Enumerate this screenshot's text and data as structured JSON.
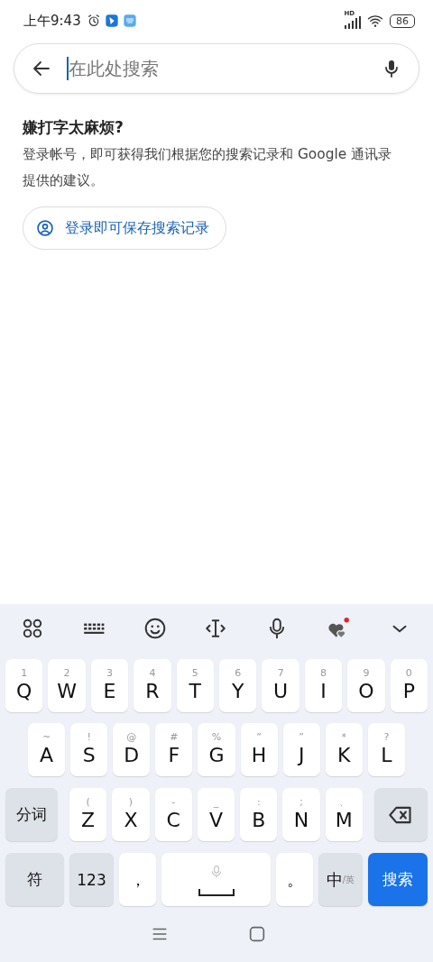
{
  "status_bar": {
    "time": "上午9:43",
    "network": "HD",
    "battery": "86"
  },
  "search": {
    "placeholder": "在此处搜索"
  },
  "prompt": {
    "title": "嫌打字太麻烦?",
    "text": "登录帐号，即可获得我们根据您的搜索记录和 Google 通讯录提供的建议。",
    "button": "登录即可保存搜索记录"
  },
  "keyboard": {
    "toolbar": [
      {
        "kind": "grid"
      },
      {
        "kind": "keyboard"
      },
      {
        "kind": "emoji"
      },
      {
        "kind": "cursor"
      },
      {
        "kind": "mic"
      },
      {
        "kind": "hearts"
      },
      {
        "kind": "collapse"
      }
    ],
    "rows": [
      {
        "keys": [
          {
            "kind": "letter",
            "label": "Q",
            "hint": "1"
          },
          {
            "kind": "letter",
            "label": "W",
            "hint": "2"
          },
          {
            "kind": "letter",
            "label": "E",
            "hint": "3"
          },
          {
            "kind": "letter",
            "label": "R",
            "hint": "4"
          },
          {
            "kind": "letter",
            "label": "T",
            "hint": "5"
          },
          {
            "kind": "letter",
            "label": "Y",
            "hint": "6"
          },
          {
            "kind": "letter",
            "label": "U",
            "hint": "7"
          },
          {
            "kind": "letter",
            "label": "I",
            "hint": "8"
          },
          {
            "kind": "letter",
            "label": "O",
            "hint": "9"
          },
          {
            "kind": "letter",
            "label": "P",
            "hint": "0"
          }
        ]
      },
      {
        "keys": [
          {
            "kind": "letter",
            "label": "A",
            "hint": "~"
          },
          {
            "kind": "letter",
            "label": "S",
            "hint": "!"
          },
          {
            "kind": "letter",
            "label": "D",
            "hint": "@"
          },
          {
            "kind": "letter",
            "label": "F",
            "hint": "#"
          },
          {
            "kind": "letter",
            "label": "G",
            "hint": "%"
          },
          {
            "kind": "letter",
            "label": "H",
            "hint": "“"
          },
          {
            "kind": "letter",
            "label": "J",
            "hint": "”"
          },
          {
            "kind": "letter",
            "label": "K",
            "hint": "*"
          },
          {
            "kind": "letter",
            "label": "L",
            "hint": "?"
          }
        ]
      },
      {
        "keys": [
          {
            "kind": "function",
            "label": "分词"
          },
          {
            "kind": "letter",
            "label": "Z",
            "hint": "("
          },
          {
            "kind": "letter",
            "label": "X",
            "hint": ")"
          },
          {
            "kind": "letter",
            "label": "C",
            "hint": "-"
          },
          {
            "kind": "letter",
            "label": "V",
            "hint": "_"
          },
          {
            "kind": "letter",
            "label": "B",
            "hint": ":"
          },
          {
            "kind": "letter",
            "label": "N",
            "hint": ";"
          },
          {
            "kind": "letter",
            "label": "M",
            "hint": "、"
          },
          {
            "kind": "backspace"
          }
        ]
      },
      {
        "keys": [
          {
            "kind": "function",
            "label": "符"
          },
          {
            "kind": "function",
            "label": "123"
          },
          {
            "kind": "punct",
            "label": "，"
          },
          {
            "kind": "space"
          },
          {
            "kind": "punct",
            "label": "。"
          },
          {
            "kind": "lang",
            "label": "中",
            "hint": "/英"
          },
          {
            "kind": "action",
            "label": "搜索"
          }
        ]
      }
    ]
  },
  "nav_bar": [
    {
      "kind": "menu"
    },
    {
      "kind": "home"
    }
  ]
}
